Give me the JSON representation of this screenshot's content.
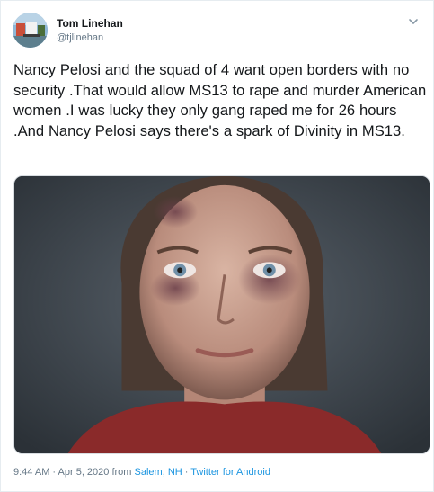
{
  "author": {
    "name": "Tom Linehan",
    "handle": "@tjlinehan"
  },
  "tweet": {
    "text": "Nancy Pelosi and the squad of 4 want open borders with no security .That would allow MS13 to rape and murder American women .I was lucky they only gang raped me for 26 hours .And Nancy Pelosi says there's a spark of Divinity in MS13."
  },
  "footer": {
    "time": "9:44 AM",
    "sep1": " · ",
    "date": "Apr 5, 2020",
    "from_label": " from ",
    "location": "Salem, NH",
    "sep2": " · ",
    "source": "Twitter for Android"
  },
  "icons": {
    "caret": "chevron-down-icon",
    "avatar": "avatar-image"
  },
  "colors": {
    "link": "#1b95e0",
    "muted": "#657786",
    "text": "#14171a"
  }
}
